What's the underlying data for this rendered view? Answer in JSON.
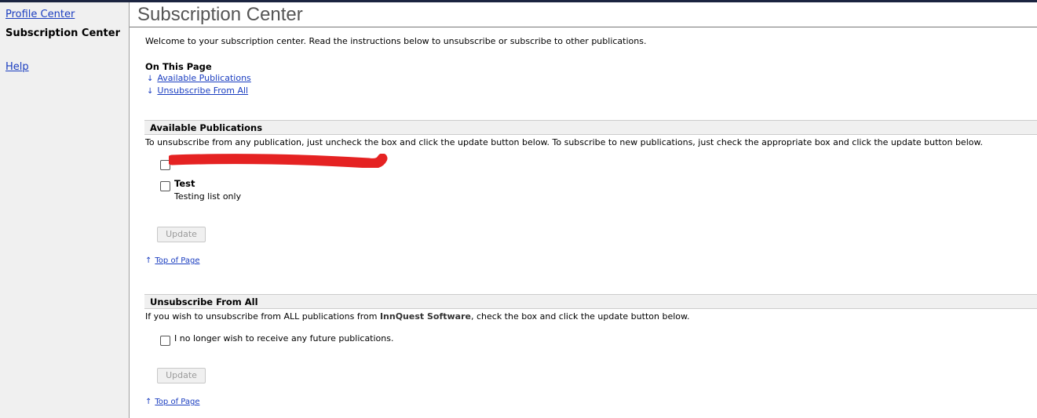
{
  "sidebar": {
    "profile_center": "Profile Center",
    "subscription_center": "Subscription Center",
    "help": "Help"
  },
  "page": {
    "title": "Subscription Center",
    "welcome": "Welcome to your subscription center. Read the instructions below to unsubscribe or subscribe to other publications.",
    "on_this_page": "On This Page",
    "anchors": [
      {
        "arrow": "↓",
        "label": "Available Publications"
      },
      {
        "arrow": "↓",
        "label": "Unsubscribe From All"
      }
    ]
  },
  "available": {
    "header": "Available Publications",
    "instructions": "To unsubscribe from any publication, just uncheck the box and click the update button below. To subscribe to new publications, just check the appropriate box and click the update button below.",
    "publications": [
      {
        "name": "[redacted]",
        "description": "",
        "checked": false,
        "redacted": true
      },
      {
        "name": "Test",
        "description": "Testing list only",
        "checked": false
      }
    ],
    "update_label": "Update",
    "top_link": "Top of Page",
    "top_arrow": "↑"
  },
  "unsubscribe": {
    "header": "Unsubscribe From All",
    "instructions_before": "If you wish to unsubscribe from ALL publications from ",
    "company": "InnQuest Software",
    "instructions_after": ", check the box and click the update button below.",
    "checkbox_label": "I no longer wish to receive any future publications.",
    "checked": false,
    "update_label": "Update",
    "top_link": "Top of Page",
    "top_arrow": "↑"
  },
  "colors": {
    "link": "#1a3dc0",
    "redaction": "#e52222",
    "top_border": "#1b2440"
  }
}
